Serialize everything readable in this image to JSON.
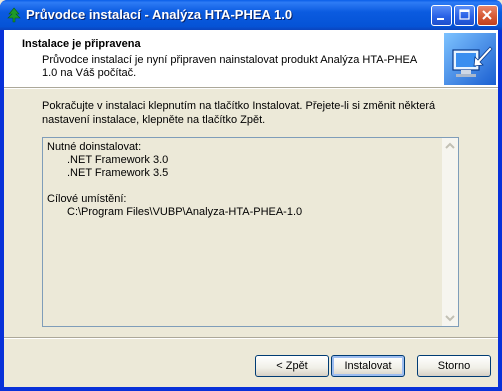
{
  "window": {
    "title": "Průvodce instalací - Analýza HTA-PHEA 1.0",
    "icon": "tree-icon"
  },
  "titlebar_buttons": [
    "minimize-icon",
    "maximize-icon",
    "close-icon"
  ],
  "header": {
    "title": "Instalace je připravena",
    "subtitle": "Průvodce instalací je nyní připraven nainstalovat produkt Analýza HTA-PHEA 1.0 na Váš počítač.",
    "logo": "computer-install-icon"
  },
  "intro": "Pokračujte v instalaci klepnutím na tlačítko Instalovat. Přejete-li si změnit některá nastavení instalace, klepněte na tlačítko Zpět.",
  "memo": {
    "prereq_heading": "Nutné doinstalovat:",
    "prereq_items": [
      ".NET Framework 3.0",
      ".NET Framework 3.5"
    ],
    "dest_heading": "Cílové umístění:",
    "dest_path": "C:\\Program Files\\VUBP\\Analyza-HTA-PHEA-1.0"
  },
  "buttons": {
    "back": "< Zpět",
    "install": "Instalovat",
    "cancel": "Storno"
  },
  "colors": {
    "titlebar": "#0a5ee8",
    "dialog_bg": "#ece9d8",
    "memo_border": "#7f9db9"
  }
}
